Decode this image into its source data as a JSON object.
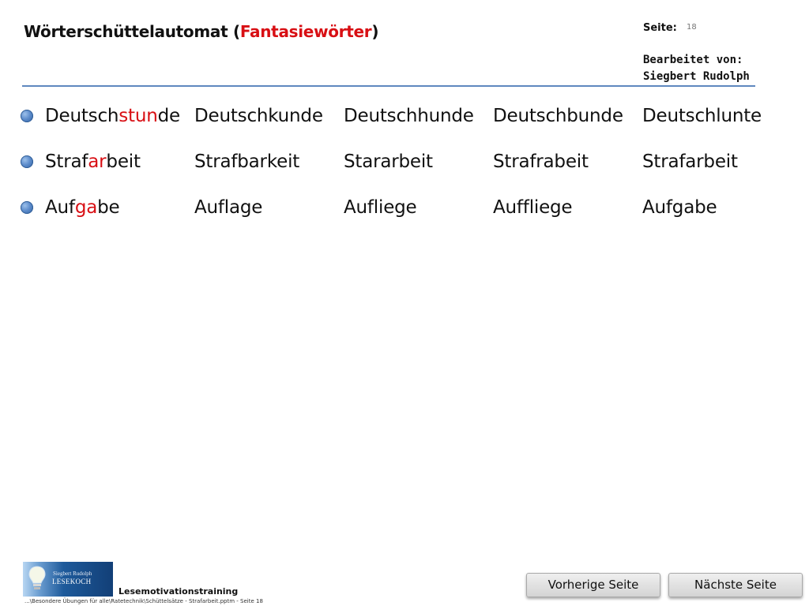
{
  "header": {
    "title_main": "Wörterschüttelautomat (",
    "title_highlight": "Fantasiewörter",
    "title_end": ")",
    "page_label": "Seite:",
    "page_number": "18",
    "edited_by_label": "Bearbeitet von:",
    "editor_name": "Siegbert Rudolph"
  },
  "rows": [
    {
      "target_parts": [
        "Deutsch",
        "stun",
        "de"
      ],
      "variants": [
        "Deutschkunde",
        "Deutschhunde",
        "Deutschbunde",
        "Deutschlunte"
      ]
    },
    {
      "target_parts": [
        "Straf",
        "ar",
        "beit"
      ],
      "variants": [
        "Strafbarkeit",
        "Stararbeit",
        "Strafrabeit",
        "Strafarbeit"
      ]
    },
    {
      "target_parts": [
        "Auf",
        "ga",
        "be"
      ],
      "variants": [
        "Auflage",
        "Aufliege",
        "Auffliege",
        "Aufgabe"
      ]
    }
  ],
  "footer": {
    "logo_small_text": "Siegbert Rudolph",
    "logo_main_text": "LESEKOCH",
    "label": "Lesemotivationstraining",
    "path": "...\\Besondere Übungen für alle\\Ratetechnik\\Schüttelsätze - Strafarbeit.pptm - Seite 18",
    "previous_button": "Vorherige Seite",
    "next_button": "Nächste Seite"
  },
  "colors": {
    "highlight": "#d80f14",
    "rule": "#5f88bf",
    "bullet": "#5d8ccb",
    "logo_background": "#1e5a9b",
    "button_background": "#d4d4d4"
  },
  "icons": {
    "bullet": "blue-bullet-icon",
    "logo": "lightbulb-logo-icon"
  }
}
